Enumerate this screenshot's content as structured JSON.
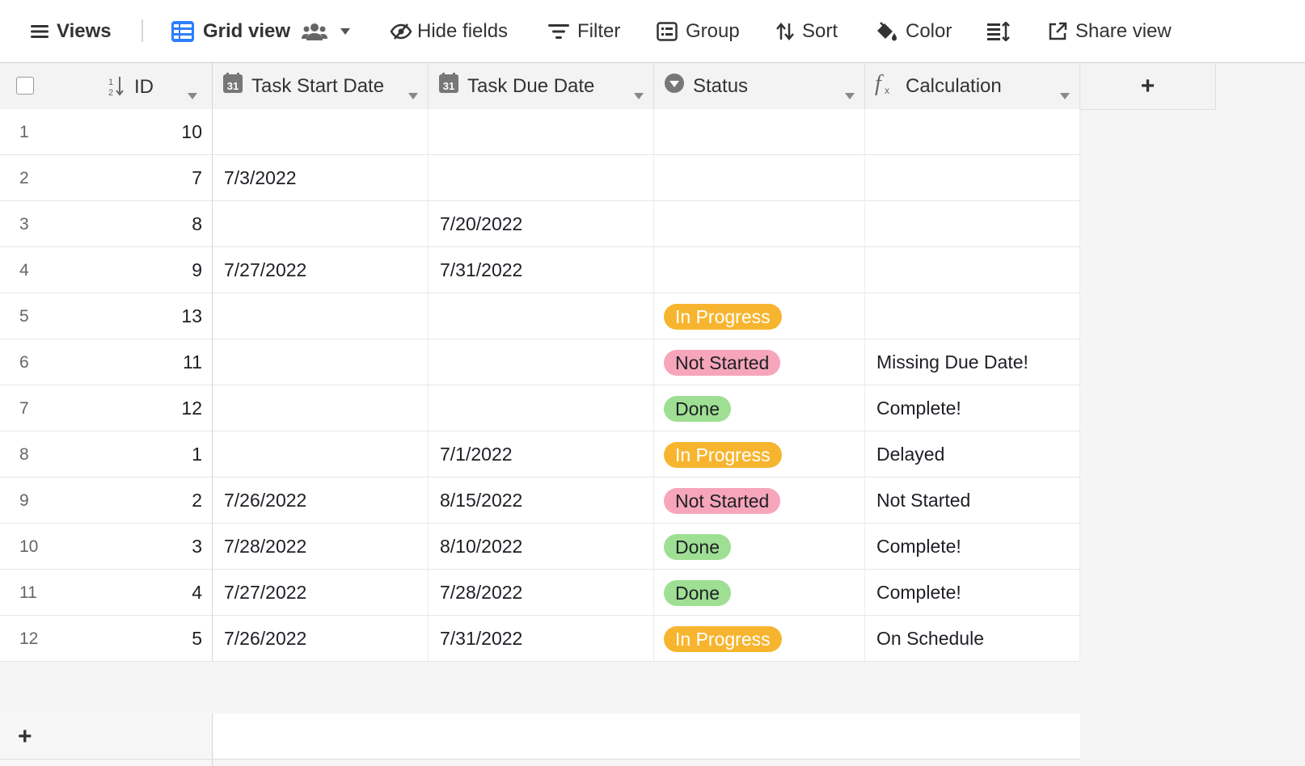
{
  "toolbar": {
    "views_label": "Views",
    "grid_view_label": "Grid view",
    "hide_fields_label": "Hide fields",
    "filter_label": "Filter",
    "group_label": "Group",
    "sort_label": "Sort",
    "color_label": "Color",
    "share_view_label": "Share view"
  },
  "columns": {
    "id": "ID",
    "start": "Task Start Date",
    "due": "Task Due Date",
    "status": "Status",
    "calc": "Calculation",
    "add": "+"
  },
  "status_colors": {
    "In Progress": {
      "bg": "#f7b52f",
      "fg": "#ffffff"
    },
    "Not Started": {
      "bg": "#f6a5ba",
      "fg": "#1d1f25"
    },
    "Done": {
      "bg": "#9fdf93",
      "fg": "#1d1f25"
    }
  },
  "rows": [
    {
      "num": "1",
      "id": "10",
      "start": "",
      "due": "",
      "status": "",
      "calc": ""
    },
    {
      "num": "2",
      "id": "7",
      "start": "7/3/2022",
      "due": "",
      "status": "",
      "calc": ""
    },
    {
      "num": "3",
      "id": "8",
      "start": "",
      "due": "7/20/2022",
      "status": "",
      "calc": ""
    },
    {
      "num": "4",
      "id": "9",
      "start": "7/27/2022",
      "due": "7/31/2022",
      "status": "",
      "calc": ""
    },
    {
      "num": "5",
      "id": "13",
      "start": "",
      "due": "",
      "status": "In Progress",
      "calc": ""
    },
    {
      "num": "6",
      "id": "11",
      "start": "",
      "due": "",
      "status": "Not Started",
      "calc": "Missing Due Date!"
    },
    {
      "num": "7",
      "id": "12",
      "start": "",
      "due": "",
      "status": "Done",
      "calc": "Complete!"
    },
    {
      "num": "8",
      "id": "1",
      "start": "",
      "due": "7/1/2022",
      "status": "In Progress",
      "calc": "Delayed"
    },
    {
      "num": "9",
      "id": "2",
      "start": "7/26/2022",
      "due": "8/15/2022",
      "status": "Not Started",
      "calc": "Not Started"
    },
    {
      "num": "10",
      "id": "3",
      "start": "7/28/2022",
      "due": "8/10/2022",
      "status": "Done",
      "calc": "Complete!"
    },
    {
      "num": "11",
      "id": "4",
      "start": "7/27/2022",
      "due": "7/28/2022",
      "status": "Done",
      "calc": "Complete!"
    },
    {
      "num": "12",
      "id": "5",
      "start": "7/26/2022",
      "due": "7/31/2022",
      "status": "In Progress",
      "calc": "On Schedule"
    }
  ],
  "add_row_symbol": "+"
}
